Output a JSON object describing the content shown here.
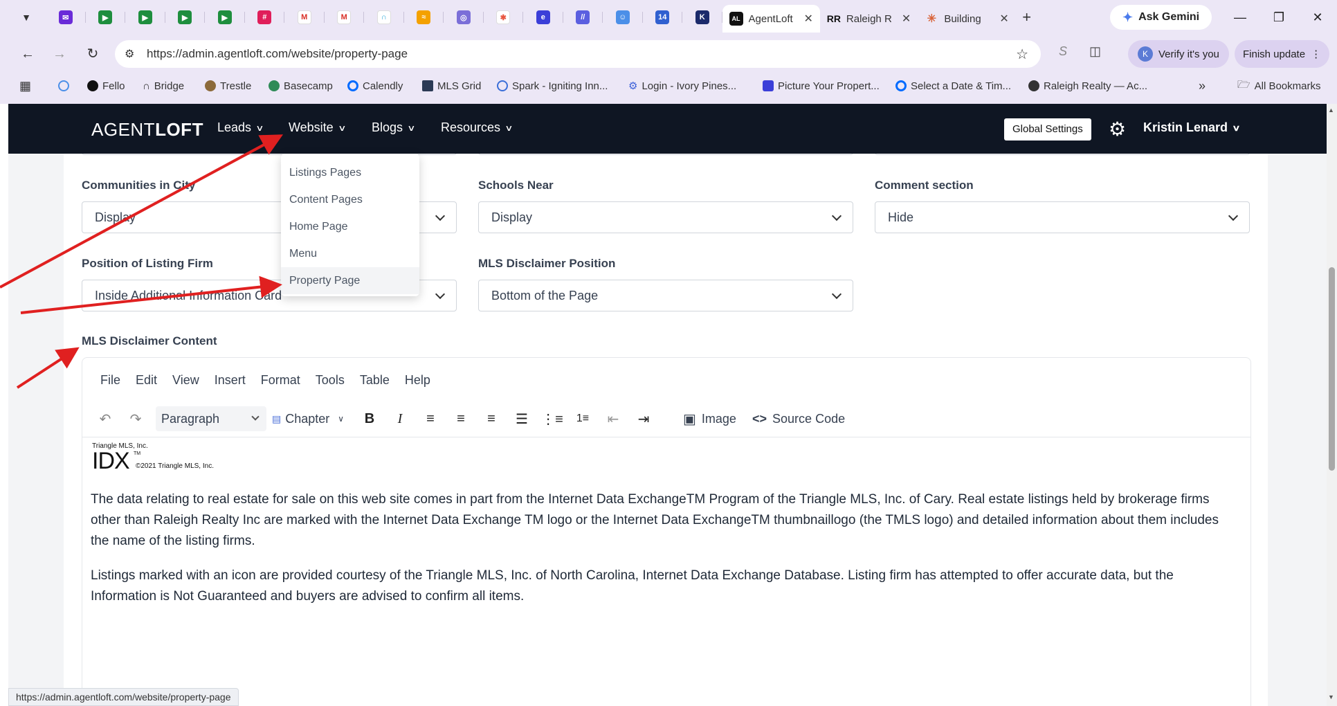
{
  "browser": {
    "tabs": [
      {
        "label": "AgentLoft",
        "icon": "agentloft-icon",
        "active": true
      },
      {
        "label": "Raleigh R",
        "icon": "raleigh-realty-icon",
        "active": false
      },
      {
        "label": "Building",
        "icon": "claude-icon",
        "active": false
      }
    ],
    "gemini_label": "Ask Gemini",
    "url": "https://admin.agentloft.com/website/property-page",
    "verify_label": "Verify it's you",
    "finish_update_label": "Finish update",
    "avatar_letter": "K",
    "bookmarks": [
      "Fello",
      "Bridge",
      "Trestle",
      "Basecamp",
      "Calendly",
      "MLS Grid",
      "Spark - Igniting Inn...",
      "Login - Ivory Pines...",
      "Picture Your Propert...",
      "Select a Date & Tim...",
      "Raleigh Realty — Ac..."
    ],
    "all_bookmarks_label": "All Bookmarks",
    "status_url": "https://admin.agentloft.com/website/property-page"
  },
  "app": {
    "logo_light": "AGENT",
    "logo_bold": "LOFT",
    "nav": [
      "Leads",
      "Website",
      "Blogs",
      "Resources"
    ],
    "global_settings_label": "Global Settings",
    "user_name": "Kristin Lenard",
    "website_menu": [
      "Listings Pages",
      "Content Pages",
      "Home Page",
      "Menu",
      "Property Page"
    ]
  },
  "form": {
    "communities_label": "Communities in City",
    "communities_value": "Display",
    "schools_label": "Schools Near",
    "schools_value": "Display",
    "comment_label": "Comment section",
    "comment_value": "Hide",
    "listing_firm_label": "Position of Listing Firm",
    "listing_firm_value": "Inside Additional Information Card",
    "mls_position_label": "MLS Disclaimer Position",
    "mls_position_value": "Bottom of the Page",
    "mls_content_label": "MLS Disclaimer Content"
  },
  "editor": {
    "menu": [
      "File",
      "Edit",
      "View",
      "Insert",
      "Format",
      "Tools",
      "Table",
      "Help"
    ],
    "paragraph_label": "Paragraph",
    "chapter_label": "Chapter",
    "image_label": "Image",
    "source_code_label": "Source Code",
    "logo_caption": "Triangle MLS, Inc.",
    "logo_mark": "IDX",
    "logo_tm": "TM",
    "logo_copyright": "©2021  Triangle MLS, Inc.",
    "paragraph1": "The data relating to real estate for sale on this web site comes in part from the Internet Data ExchangeTM Program of the Triangle MLS, Inc. of Cary. Real estate listings held by brokerage firms other than Raleigh Realty Inc are marked with the Internet Data Exchange TM logo or the Internet Data ExchangeTM thumbnaillogo (the TMLS logo) and detailed information about them includes the name of the listing firms.",
    "paragraph2": "Listings marked with an icon are provided courtesy of the Triangle MLS, Inc. of North Carolina, Internet Data Exchange Database. Listing firm has attempted to offer accurate data, but the Information is Not Guaranteed and buyers are advised to confirm all items."
  },
  "colors": {
    "nav_bg": "#0f1623",
    "annotation_arrow": "#e02020",
    "chrome_bg": "#ece7f6"
  }
}
